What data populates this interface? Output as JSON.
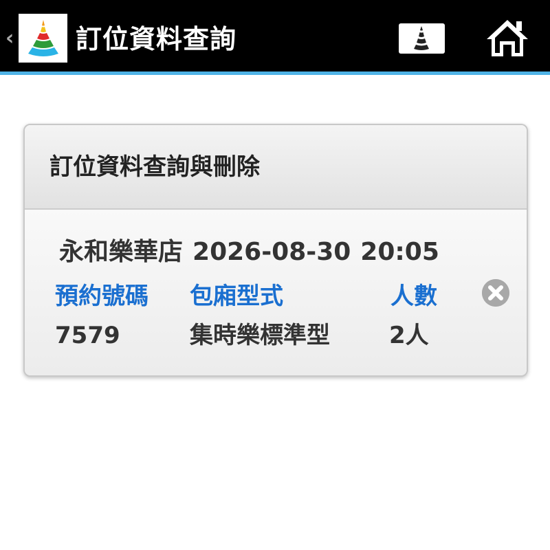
{
  "header": {
    "back_icon": "chevron-left-icon",
    "logo_icon": "layered-cone-logo",
    "title": "訂位資料查詢",
    "menu_icon": "layered-cone-menu-icon",
    "home_icon": "home-icon",
    "background_color": "#000000",
    "accent_color": "#4fb3e6"
  },
  "reservation_card": {
    "title": "訂位資料查詢與刪除",
    "store": "永和樂華店",
    "date": "2026-08-30",
    "time": "20:05",
    "labels": {
      "booking_number": "預約號碼",
      "room_type": "包廂型式",
      "party_size": "人數"
    },
    "values": {
      "booking_number": "7579",
      "room_type": "集時樂標準型",
      "party_size": "2人"
    },
    "label_color": "#1a6fd0",
    "delete_icon": "close-circle-icon"
  }
}
